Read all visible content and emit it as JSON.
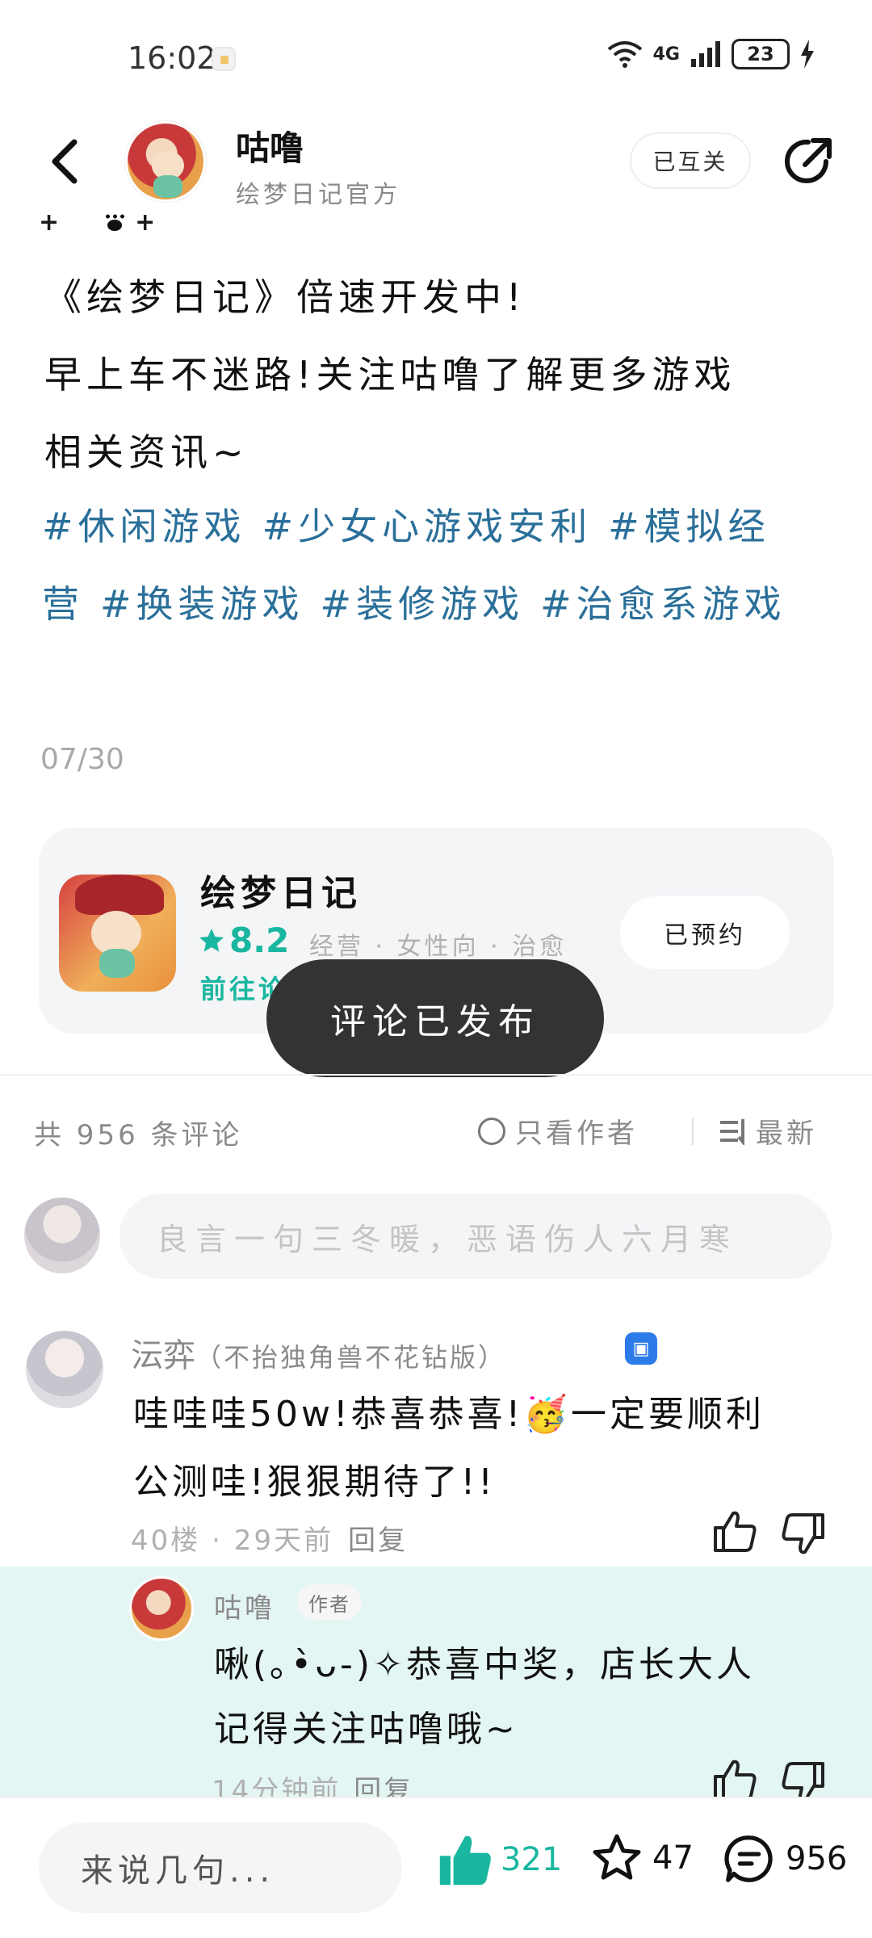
{
  "status_bar": {
    "time": "16:02",
    "network": "4G",
    "battery": "23"
  },
  "header": {
    "author_name": "咕噜",
    "author_subtitle": "绘梦日记官方",
    "follow_label": "已互关"
  },
  "post": {
    "lines": [
      "《绘梦日记》倍速开发中!",
      "早上车不迷路!关注咕噜了解更多游戏",
      "相关资讯~"
    ],
    "tags_line1": [
      "#休闲游戏",
      "#少女心游戏安利",
      "#模拟经"
    ],
    "tags_line2": [
      "营",
      "#换装游戏",
      "#装修游戏",
      "#治愈系游戏"
    ],
    "page_indicator": "07/30"
  },
  "game_card": {
    "name": "绘梦日记",
    "rating": "8.2",
    "tags": "经营 · 女性向 · 治愈",
    "goto_label": "前往论",
    "reserve_label": "已预约"
  },
  "toast": {
    "message": "评论已发布"
  },
  "comments_header": {
    "count_label": "共 956 条评论",
    "only_author_label": "只看作者",
    "sort_label": "最新"
  },
  "comment_input": {
    "placeholder": "良言一句三冬暖，恶语伤人六月寒"
  },
  "comments": [
    {
      "user": "沄弈",
      "user_suffix": "（不抬独角兽不花钻版）",
      "text_lines": [
        "哇哇哇50w!恭喜恭喜!🥳一定要顺利",
        "公测哇!狠狠期待了!!"
      ],
      "floor": "40楼",
      "time": "29天前",
      "reply_label": "回复"
    }
  ],
  "reply": {
    "user": "咕噜",
    "author_tag": "作者",
    "text_lines": [
      "啾(｡•̀ᴗ-)✧恭喜中奖，店长大人",
      "记得关注咕噜哦~"
    ],
    "time": "14分钟前",
    "reply_label": "回复"
  },
  "bottom_bar": {
    "input_placeholder": "来说几句...",
    "like_count": "321",
    "star_count": "47",
    "comment_count": "956"
  },
  "colors": {
    "accent": "#19b6a0",
    "tag_blue": "#2a6f9a",
    "reply_bg": "#e4f6f4",
    "toast_bg": "#333333"
  }
}
